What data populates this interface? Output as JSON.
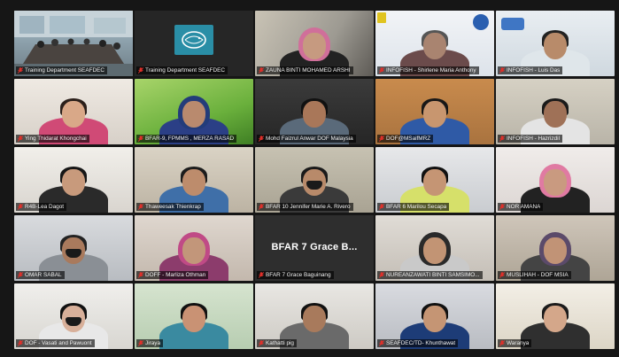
{
  "meeting": {
    "participants": [
      {
        "name": "Training Department SEAFDEC",
        "kind": "room",
        "active": true
      },
      {
        "name": "Training Department SEAFDEC",
        "kind": "logo",
        "logo": "seafdec-logo"
      },
      {
        "name": "ZAUNA BINTI MOHAMED ARSHI",
        "kind": "person"
      },
      {
        "name": "INFOFISH - Shirlene Maria Anthony",
        "kind": "person",
        "banner": "INFOFISH"
      },
      {
        "name": "INFOFISH - Luis Das",
        "kind": "person",
        "banner": "INFOFISH"
      },
      {
        "name": "Ying Thidarat Khongchai",
        "kind": "person"
      },
      {
        "name": "BFAR-9, FPMMS , MERZA RASAD",
        "kind": "person"
      },
      {
        "name": "Mohd Faizrul Anwar DOF Malaysia",
        "kind": "person"
      },
      {
        "name": "DOF@MSaifMRZ",
        "kind": "person"
      },
      {
        "name": "INFOFISH - Hazrizdil",
        "kind": "person"
      },
      {
        "name": "R4B-Lea Dagot",
        "kind": "person"
      },
      {
        "name": "Thaweesak Thienkrap",
        "kind": "person"
      },
      {
        "name": "BFAR 10 Jennifer Marie A. Rivero",
        "kind": "person"
      },
      {
        "name": "BFAR 6 Marilou Secapa",
        "kind": "person"
      },
      {
        "name": "NOR AMANA",
        "kind": "person"
      },
      {
        "name": "OMAR SABAL",
        "kind": "person"
      },
      {
        "name": "DOFF - Marliza Othman",
        "kind": "person"
      },
      {
        "name": "BFAR 7 Grace Baguinang",
        "kind": "text",
        "display": "BFAR 7 Grace B..."
      },
      {
        "name": "NUREANZAWATI BINTI SAMSIMO...",
        "kind": "person"
      },
      {
        "name": "MUSLIHAH - DOF MSIA",
        "kind": "person"
      },
      {
        "name": "DOF - Vasati and Pawuont",
        "kind": "person"
      },
      {
        "name": "Jiraya",
        "kind": "person"
      },
      {
        "name": "Kathatti pig",
        "kind": "person"
      },
      {
        "name": "SEAFDEC/TD- Khunthawat",
        "kind": "person"
      },
      {
        "name": "Waranya",
        "kind": "person"
      }
    ]
  },
  "colors": {
    "background": "#161616",
    "active_border": "#d8e63a",
    "mic_muted": "#e0302a",
    "nameplate_text": "#f1f1f1"
  }
}
